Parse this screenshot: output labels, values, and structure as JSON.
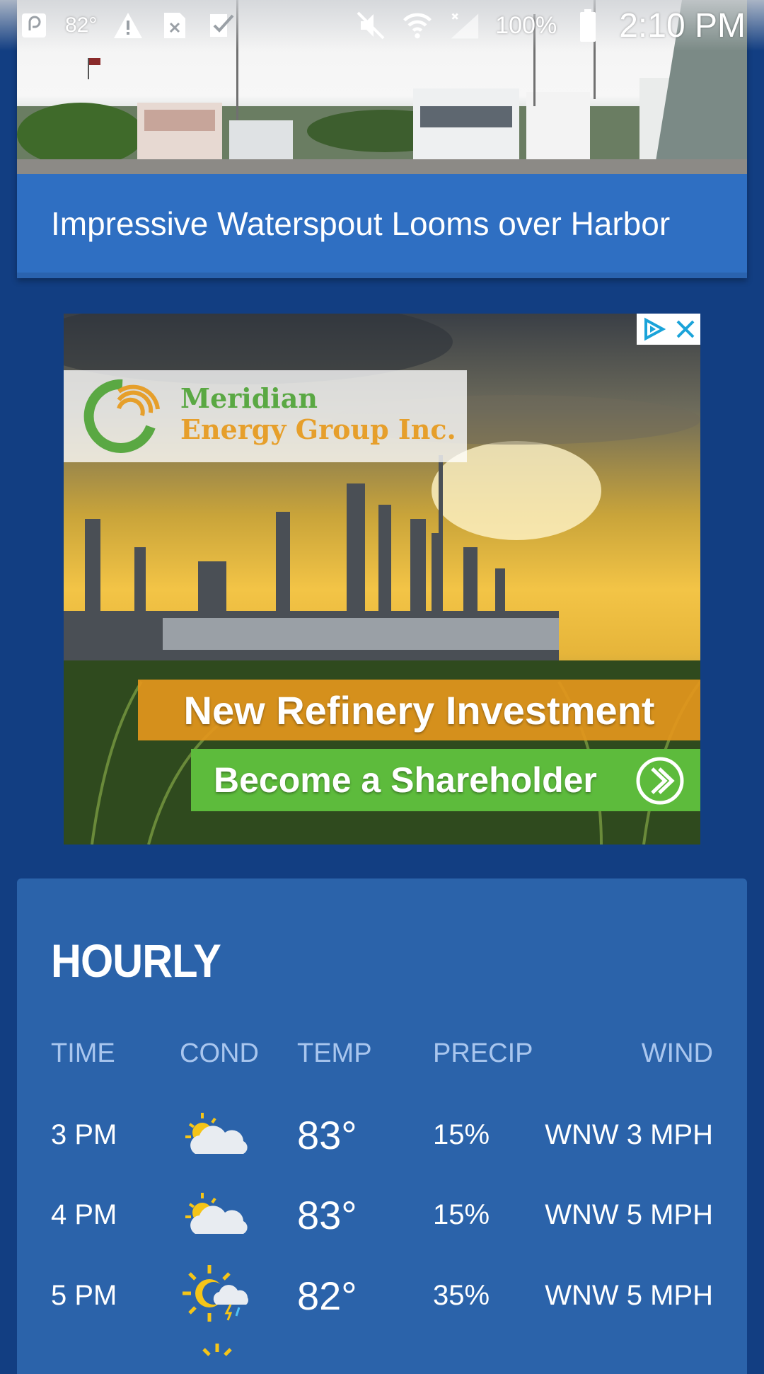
{
  "status_bar": {
    "temperature": "82°",
    "battery_percent": "100%",
    "clock": "2:10 PM",
    "icons": [
      "app-icon",
      "warning-icon",
      "close-box-icon",
      "check-icon",
      "mute-icon",
      "wifi-icon",
      "signal-icon",
      "battery-icon"
    ]
  },
  "news": {
    "title": "Impressive Waterspout Looms over Harbor"
  },
  "ad": {
    "company_line1": "Meridian",
    "company_line2": "Energy Group Inc.",
    "headline": "New Refinery Investment",
    "cta": "Become a Shareholder",
    "colors": {
      "orange": "#e4961c",
      "green": "#5dbb3c"
    }
  },
  "hourly": {
    "title": "HOURLY",
    "headers": {
      "time": "TIME",
      "cond": "COND",
      "temp": "TEMP",
      "precip": "PRECIP",
      "wind": "WIND"
    },
    "rows": [
      {
        "time": "3 PM",
        "cond": "partly-cloudy-icon",
        "temp": "83°",
        "precip": "15%",
        "wind": "WNW 3 MPH"
      },
      {
        "time": "4 PM",
        "cond": "partly-cloudy-icon",
        "temp": "83°",
        "precip": "15%",
        "wind": "WNW 5 MPH"
      },
      {
        "time": "5 PM",
        "cond": "sun-thunder-shower-icon",
        "temp": "82°",
        "precip": "35%",
        "wind": "WNW 5 MPH"
      }
    ]
  }
}
